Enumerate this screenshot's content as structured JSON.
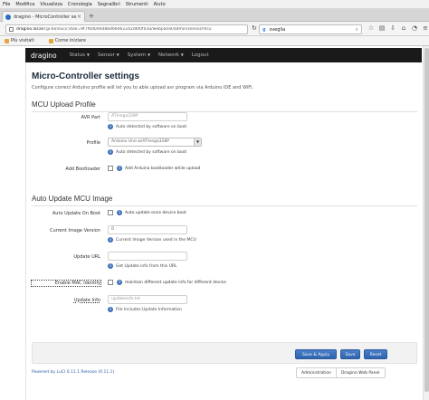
{
  "browser": {
    "menu": [
      "File",
      "Modifica",
      "Visualizza",
      "Cronologia",
      "Segnalibri",
      "Strumenti",
      "Aiuto"
    ],
    "tab_title": "dragino - MicroController se...",
    "tab_close": "×",
    "new_tab": "+",
    "url_host": "dragino.local",
    "url_path": "/cgi-bin/luci/;stok=9f7f6d0d4d8bd66062242d6f0f03a/webpanel/admin/sensor/mcu",
    "search_engine": "g",
    "search_value": "sveglia",
    "bookmarks": [
      "Più visitati",
      "Come iniziare"
    ]
  },
  "nav": {
    "brand": "dragino",
    "items": [
      "Status",
      "Sensor",
      "System",
      "Network",
      "Logout"
    ]
  },
  "page": {
    "title": "Micro-Controller settings",
    "description": "Configure correct Arduino profile will let you to able upload avr program via Arduino IDE and WiFi."
  },
  "mcu_upload": {
    "section_title": "MCU Upload Profile",
    "avr_part_label": "AVR Part",
    "avr_part_placeholder": "ATmega328P",
    "avr_part_help": "Auto detected by software on boot",
    "profile_label": "Profile",
    "profile_value": "Arduino Uno w/ATmega328P",
    "profile_help": "Auto detected by software on boot",
    "bootloader_label": "Add Bootloader",
    "bootloader_text": "Add Arduino bootloader while upload"
  },
  "auto_update": {
    "section_title": "Auto Update MCU Image",
    "on_boot_label": "Auto Update On Boot",
    "on_boot_text": "Auto update once device boot",
    "current_version_label": "Current Image Version",
    "current_version_value": "0",
    "current_version_help": "Current Image Version used in the MCU",
    "update_url_label": "Update URL",
    "update_url_help": "Get Update info from this URL",
    "mac_label": "Enable MAC Identify",
    "mac_text": "maintain different update info for different device",
    "update_info_label": "Update Info",
    "update_info_placeholder": "updateinfo.txt",
    "update_info_help": "File Includes Update Information"
  },
  "actions": {
    "save_apply": "Save & Apply",
    "save": "Save",
    "reset": "Reset"
  },
  "footer": {
    "powered": "Powered by LuCI 0.11.1 Release (0.11.1)",
    "admin_link": "Administration",
    "webpanel_link": "Dragino Web Panel"
  },
  "colors": {
    "accent": "#2e63ad",
    "navbar": "#1a1a1a"
  }
}
